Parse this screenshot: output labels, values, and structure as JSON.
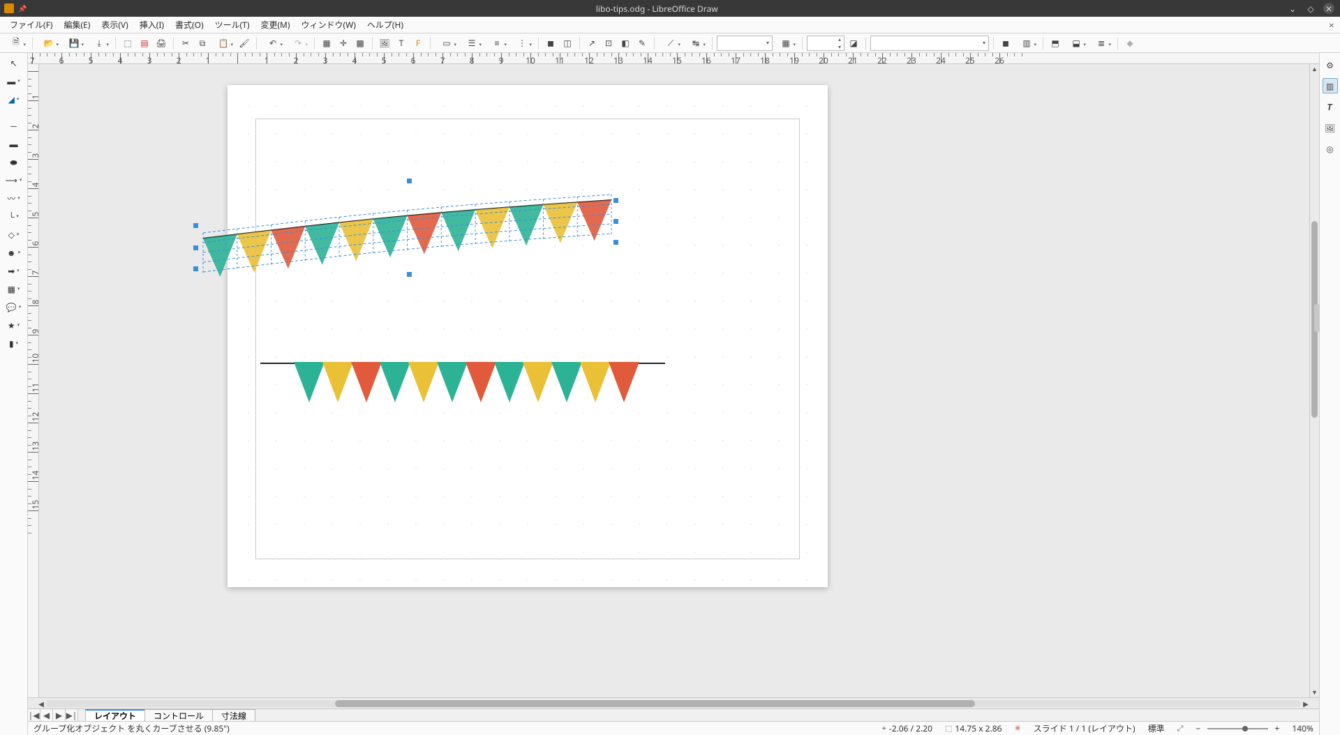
{
  "titlebar": {
    "title": "libo-tips.odg - LibreOffice Draw"
  },
  "menubar": {
    "items": [
      "ファイル(F)",
      "編集(E)",
      "表示(V)",
      "挿入(I)",
      "書式(O)",
      "ツール(T)",
      "変更(M)",
      "ウィンドウ(W)",
      "ヘルプ(H)"
    ]
  },
  "toolbar": {
    "line_width_value": "",
    "paragraph_style_value": ""
  },
  "tabs": {
    "nav": [
      "|◀",
      "◀",
      "▶",
      "▶|"
    ],
    "items": [
      "レイアウト",
      "コントロール",
      "寸法線"
    ],
    "active_index": 0
  },
  "statusbar": {
    "info": "グループ化オブジェクト を丸くカーブさせる (9.85\")",
    "pos": "-2.06 / 2.20",
    "size": "14.75 x 2.86",
    "slide": "スライド 1 / 1 (レイアウト)",
    "style": "標準",
    "zoom": "140%"
  },
  "ruler": {
    "h_labels": [
      "7",
      "6",
      "5",
      "4",
      "3",
      "2",
      "1",
      "",
      "1",
      "2",
      "3",
      "4",
      "5",
      "6",
      "7",
      "8",
      "9",
      "10",
      "11",
      "12",
      "13",
      "14",
      "15",
      "16",
      "17",
      "18",
      "19",
      "20",
      "21",
      "22",
      "23",
      "24",
      "25",
      "26"
    ],
    "v_labels": [
      "",
      "1",
      "2",
      "3",
      "4",
      "5",
      "6",
      "7",
      "8",
      "9",
      "10",
      "11",
      "12",
      "13",
      "14",
      "15"
    ]
  },
  "flag_colors": {
    "green": "#2cb396",
    "yellow": "#e9c036",
    "red": "#e05a3b"
  },
  "flags_bottom_sequence": [
    "green",
    "yellow",
    "red",
    "green",
    "yellow",
    "green",
    "red",
    "green",
    "yellow",
    "green",
    "yellow",
    "red"
  ],
  "flags_top_sequence": [
    "green",
    "yellow",
    "red",
    "green",
    "yellow",
    "green",
    "red",
    "green",
    "yellow",
    "green",
    "yellow",
    "red"
  ]
}
